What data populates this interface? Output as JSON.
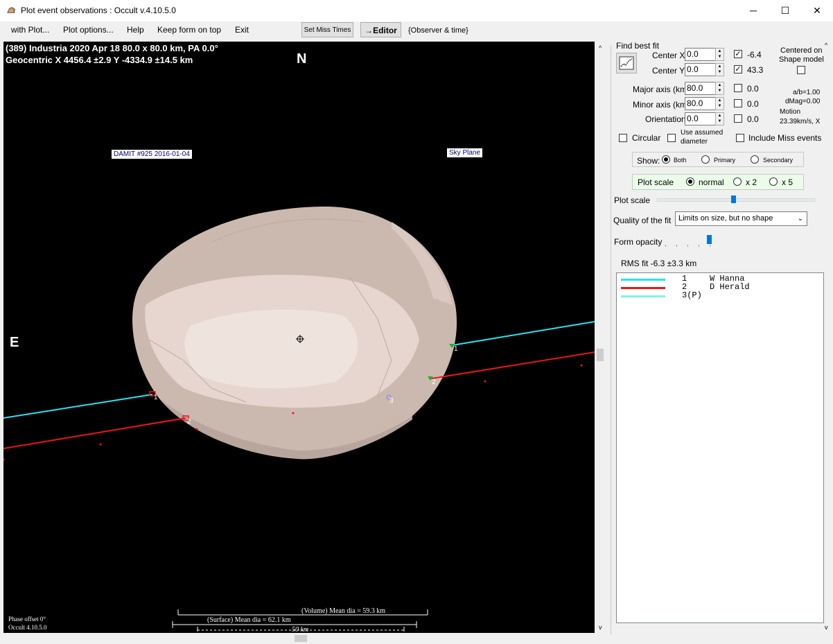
{
  "window": {
    "title": "Plot event observations : Occult v.4.10.5.0",
    "minimize_glyph": "─",
    "maximize_glyph": "☐",
    "close_glyph": "✕"
  },
  "menu": {
    "items": [
      "with Plot...",
      "Plot options...",
      "Help",
      "Keep form on top",
      "Exit"
    ],
    "set_miss_times": "Set Miss Times",
    "editor": "→Editor",
    "observer_time": "{Observer & time}"
  },
  "plot": {
    "line1": "(389) Industria  2020 Apr 18   80.0 x 80.0 km,  PA 0.0°",
    "line2": "Geocentric  X  4456.4 ±2.9  Y -4334.9 ±14.5 km",
    "north": "N",
    "east": "E",
    "damit_label": "DAMIT #925 2016-01-04",
    "sky_plane_label": "Sky Plane",
    "chord_labels": [
      "1",
      "2",
      "3",
      "1",
      "2"
    ],
    "volume_dia": "(Volume) Mean dia = 59.3 km",
    "surface_dia": "(Surface) Mean dia = 62.1 km",
    "scale_km": "50 km",
    "phase_offset": "Phase offset 0°",
    "version": "Occult 4.10.5.0",
    "chord_colors": {
      "chord1": "#23e5f5",
      "chord2": "#f01414",
      "chord3": "#80f5dc"
    },
    "shape_color": "#cbb9b0"
  },
  "panel": {
    "find_best_fit": "Find best fit",
    "center_x_label": "Center X",
    "center_x_value": "0.0",
    "center_x_fit": "-6.4",
    "center_y_label": "Center Y",
    "center_y_value": "0.0",
    "center_y_fit": "43.3",
    "centered_on": "Centered on",
    "shape_model": "Shape model",
    "major_label": "Major axis (km)",
    "major_value": "80.0",
    "major_fit": "0.0",
    "minor_label": "Minor axis (km)",
    "minor_value": "80.0",
    "minor_fit": "0.0",
    "orient_label": "Orientation",
    "orient_value": "0.0",
    "orient_fit": "0.0",
    "ab": "a/b=1.00",
    "dmag": "dMag=0.00",
    "motion": "Motion",
    "motion_value": "23.39km/s, X",
    "circular": "Circular",
    "use_assumed": "Use assumed",
    "diameter": "diameter",
    "include_miss": "Include Miss events",
    "show_label": "Show:",
    "show_options": [
      "Both",
      "Primary",
      "Secondary"
    ],
    "plot_scale_group": "Plot scale",
    "scale_options": [
      "normal",
      "x 2",
      "x 5"
    ],
    "plot_scale_slider_label": "Plot scale",
    "quality_label": "Quality of the fit",
    "quality_value": "Limits on size, but no shape",
    "form_opacity": "Form opacity",
    "rms_fit": "RMS fit -6.3 ±3.3 km",
    "observers": [
      {
        "num": "1",
        "name": "W Hanna",
        "color": "#23e5f5"
      },
      {
        "num": "2",
        "name": "D Herald",
        "color": "#f01414"
      },
      {
        "num": "3(P)",
        "name": "",
        "color": "#80f5dc"
      }
    ]
  }
}
